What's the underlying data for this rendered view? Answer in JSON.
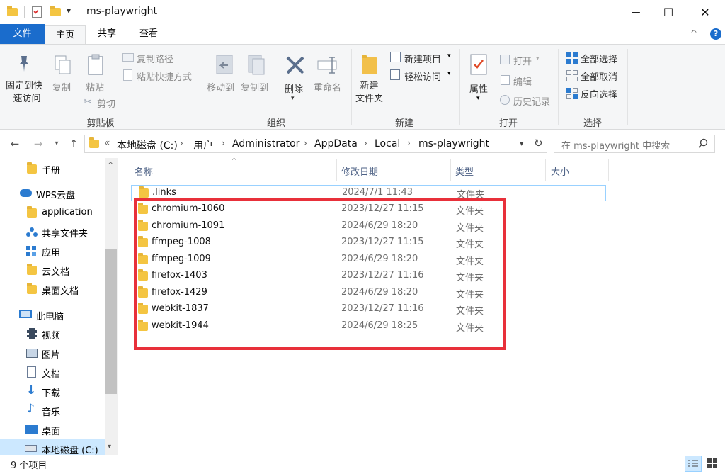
{
  "window": {
    "title": "ms-playwright",
    "minimize_glyph": "—",
    "maximize_glyph": "☐",
    "close_glyph": "✕",
    "qat_dropdown_glyph": "▾"
  },
  "tabs": {
    "file": "文件",
    "home": "主页",
    "share": "共享",
    "view": "查看",
    "help_glyph": "?",
    "collapse_glyph": "^"
  },
  "ribbon": {
    "clipboard": {
      "pin": "固定到快\n速访问",
      "pin_line1": "固定到快",
      "pin_line2": "速访问",
      "copy": "复制",
      "paste": "粘贴",
      "copy_path": "复制路径",
      "paste_shortcut": "粘贴快捷方式",
      "cut": "剪切",
      "group": "剪贴板"
    },
    "organize": {
      "move_to": "移动到",
      "copy_to": "复制到",
      "delete": "删除",
      "rename": "重命名",
      "group": "组织"
    },
    "new": {
      "new_item": "新建项目",
      "easy_access": "轻松访问",
      "new_folder_line1": "新建",
      "new_folder_line2": "文件夹",
      "group": "新建"
    },
    "open": {
      "properties": "属性",
      "open": "打开",
      "edit": "编辑",
      "history": "历史记录",
      "group": "打开"
    },
    "select": {
      "select_all": "全部选择",
      "select_none": "全部取消",
      "invert": "反向选择",
      "group": "选择"
    }
  },
  "address": {
    "overflow": "«",
    "crumbs": [
      "本地磁盘 (C:)",
      "用户",
      "Administrator",
      "AppData",
      "Local",
      "ms-playwright"
    ],
    "search_placeholder": "在 ms-playwright 中搜索"
  },
  "nav": {
    "items": [
      "手册",
      "WPS云盘",
      "application",
      "共享文件夹",
      "应用",
      "云文档",
      "桌面文档",
      "此电脑",
      "视频",
      "图片",
      "文档",
      "下载",
      "音乐",
      "桌面",
      "本地磁盘 (C:)"
    ]
  },
  "columns": {
    "name": "名称",
    "date": "修改日期",
    "type": "类型",
    "size": "大小"
  },
  "files": [
    {
      "name": ".links",
      "date": "2024/7/1 11:43",
      "type": "文件夹"
    },
    {
      "name": "chromium-1060",
      "date": "2023/12/27 11:15",
      "type": "文件夹"
    },
    {
      "name": "chromium-1091",
      "date": "2024/6/29 18:20",
      "type": "文件夹"
    },
    {
      "name": "ffmpeg-1008",
      "date": "2023/12/27 11:15",
      "type": "文件夹"
    },
    {
      "name": "ffmpeg-1009",
      "date": "2024/6/29 18:20",
      "type": "文件夹"
    },
    {
      "name": "firefox-1403",
      "date": "2023/12/27 11:16",
      "type": "文件夹"
    },
    {
      "name": "firefox-1429",
      "date": "2024/6/29 18:20",
      "type": "文件夹"
    },
    {
      "name": "webkit-1837",
      "date": "2023/12/27 11:16",
      "type": "文件夹"
    },
    {
      "name": "webkit-1944",
      "date": "2024/6/29 18:25",
      "type": "文件夹"
    }
  ],
  "status": {
    "count": "9 个项目"
  },
  "colors": {
    "accent": "#1a6ccc",
    "folder": "#f4c542",
    "highlight": "#e8303a"
  }
}
